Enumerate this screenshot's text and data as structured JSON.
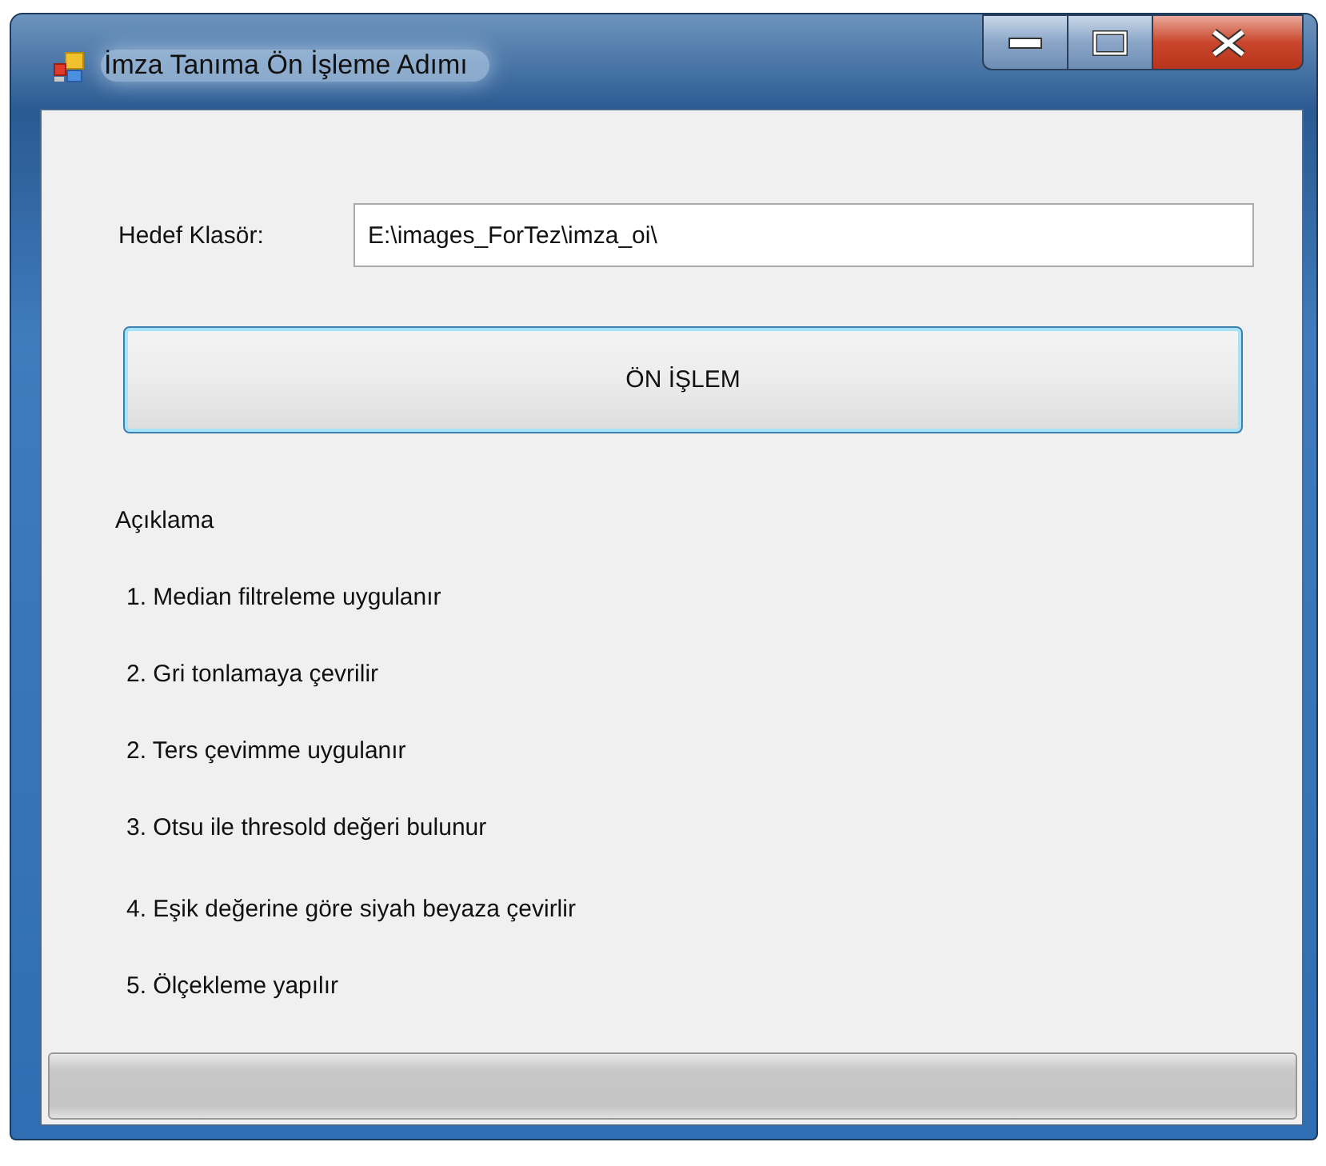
{
  "window": {
    "title": "İmza Tanıma Ön İşleme Adımı"
  },
  "target_folder": {
    "label": "Hedef Klasör:",
    "value": "E:\\images_ForTez\\imza_oi\\"
  },
  "process_button": {
    "label": "ÖN İŞLEM"
  },
  "description": {
    "heading": "Açıklama",
    "steps": [
      "1. Median filtreleme uygulanır",
      "2. Gri tonlamaya çevrilir",
      "2. Ters çevimme uygulanır",
      "3. Otsu ile thresold değeri bulunur",
      "4. Eşik değerine göre siyah beyaza çevirlir",
      "5. Ölçekleme yapılır"
    ]
  },
  "progress_bar": {
    "level": 0
  }
}
